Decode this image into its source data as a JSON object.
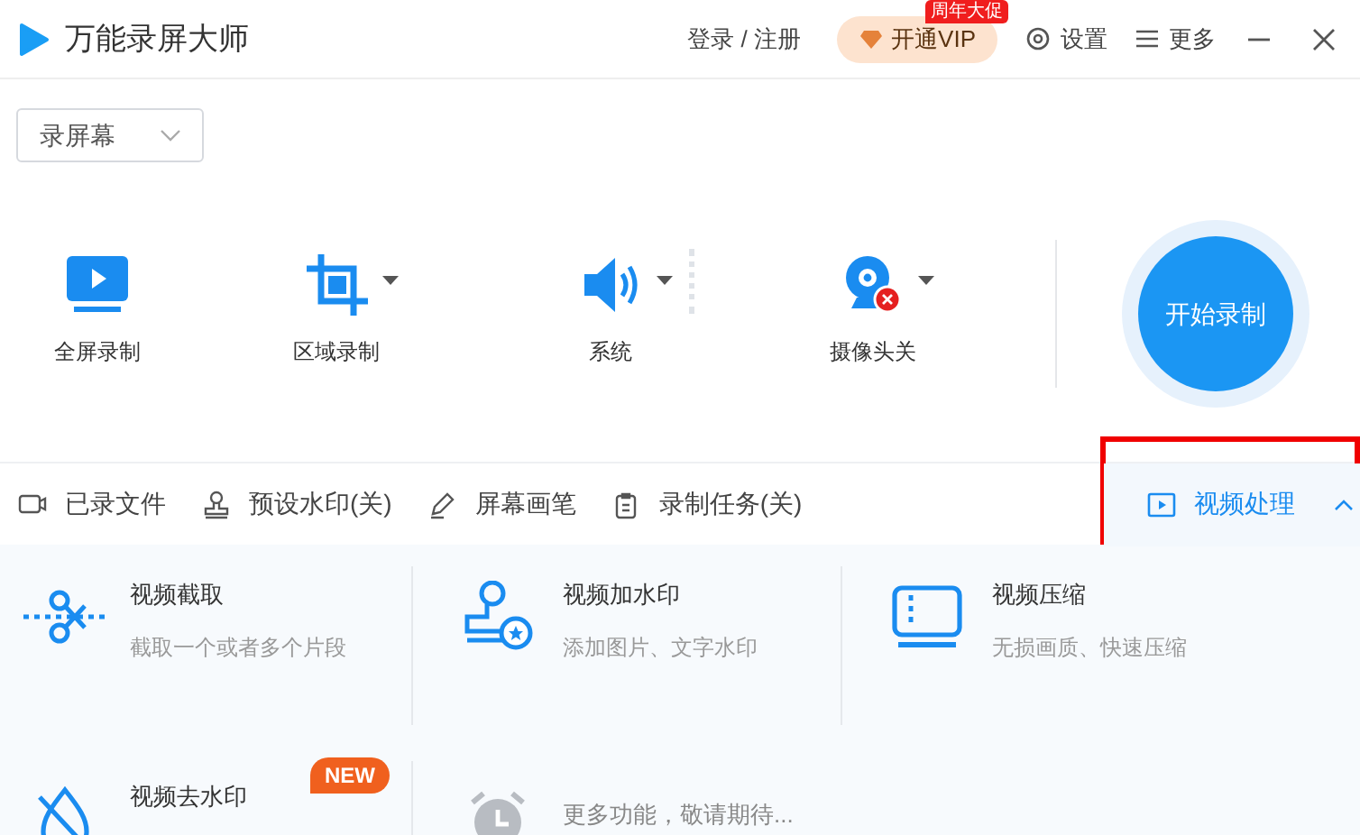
{
  "window": {
    "title": "万能录屏大师"
  },
  "header": {
    "login": "登录 / 注册",
    "vip": {
      "label": "开通VIP",
      "badge": "周年大促"
    },
    "settings": "设置",
    "more": "更多"
  },
  "mode_select": {
    "value": "录屏幕"
  },
  "record_options": [
    {
      "kind": "fullscreen",
      "label": "全屏录制",
      "dropdown": false
    },
    {
      "kind": "region",
      "label": "区域录制",
      "dropdown": true
    },
    {
      "kind": "audio",
      "label": "系统",
      "dropdown": true
    },
    {
      "kind": "camera",
      "label": "摄像头关",
      "dropdown": true
    }
  ],
  "start_button": {
    "label": "开始录制"
  },
  "toolbar": [
    {
      "kind": "files",
      "label": "已录文件",
      "selected": false
    },
    {
      "kind": "watermark",
      "label": "预设水印(关)",
      "selected": false
    },
    {
      "kind": "pen",
      "label": "屏幕画笔",
      "selected": false
    },
    {
      "kind": "task",
      "label": "录制任务(关)",
      "selected": false
    },
    {
      "kind": "video",
      "label": "视频处理",
      "selected": true,
      "expanded": true,
      "highlighted": true
    }
  ],
  "video_tools": [
    {
      "kind": "cut",
      "title": "视频截取",
      "subtitle": "截取一个或者多个片段",
      "disabled": false
    },
    {
      "kind": "stamp",
      "title": "视频加水印",
      "subtitle": "添加图片、文字水印",
      "disabled": false
    },
    {
      "kind": "compress",
      "title": "视频压缩",
      "subtitle": "无损画质、快速压缩",
      "disabled": false
    },
    {
      "kind": "unwatermark",
      "title": "视频去水印",
      "badge": "NEW",
      "disabled": false
    },
    {
      "kind": "clock",
      "title": "更多功能，敬请期待...",
      "disabled": true
    }
  ]
}
